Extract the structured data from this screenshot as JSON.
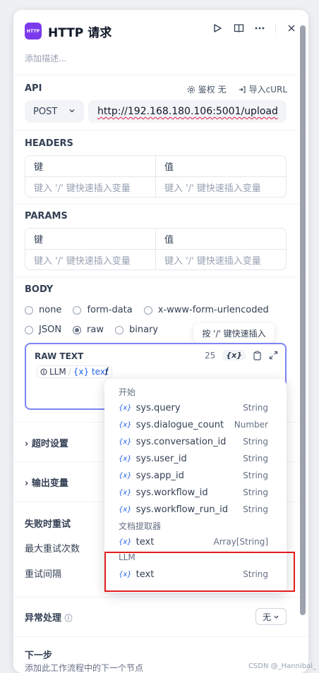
{
  "panel": {
    "app_icon_text": "HTTP",
    "title": "HTTP 请求",
    "description_placeholder": "添加描述..."
  },
  "api": {
    "label": "API",
    "auth_label": "鉴权 无",
    "import_label": "导入cURL",
    "method": "POST",
    "url": "http://192.168.180.106:5001/upload"
  },
  "headers": {
    "label": "HEADERS",
    "key_header": "键",
    "value_header": "值",
    "key_placeholder": "键入 '/' 键快速插入变量",
    "value_placeholder": "键入 '/' 键快速插入变量"
  },
  "params": {
    "label": "PARAMS",
    "key_header": "键",
    "value_header": "值",
    "key_placeholder": "键入 '/' 键快速插入变量",
    "value_placeholder": "键入 '/' 键快速插入变量"
  },
  "body": {
    "label": "BODY",
    "options": [
      "none",
      "form-data",
      "x-www-form-urlencoded",
      "JSON",
      "raw",
      "binary"
    ],
    "selected": "raw",
    "tooltip": "按 '/' 键快速插入",
    "raw_title": "RAW TEXT",
    "char_count": "25",
    "var_btn": "{x}",
    "chip_node": "LLM",
    "chip_sep": "/",
    "chip_var": "{x} text",
    "typed": "/"
  },
  "sections": {
    "timeout": "超时设置",
    "output_vars": "输出变量",
    "retry_on_fail": "失败时重试",
    "max_retries": "最大重试次数",
    "retry_interval": "重试间隔",
    "error_handling": "异常处理",
    "error_handling_value": "无",
    "next_step": "下一步",
    "next_step_desc": "添加此工作流程中的下一个节点"
  },
  "var_popup": {
    "groups": [
      {
        "title": "开始",
        "items": [
          {
            "name": "sys.query",
            "type": "String"
          },
          {
            "name": "sys.dialogue_count",
            "type": "Number"
          },
          {
            "name": "sys.conversation_id",
            "type": "String"
          },
          {
            "name": "sys.user_id",
            "type": "String"
          },
          {
            "name": "sys.app_id",
            "type": "String"
          },
          {
            "name": "sys.workflow_id",
            "type": "String"
          },
          {
            "name": "sys.workflow_run_id",
            "type": "String"
          }
        ]
      },
      {
        "title": "文档提取器",
        "items": [
          {
            "name": "text",
            "type": "Array[String]"
          }
        ]
      },
      {
        "title": "LLM",
        "items": [
          {
            "name": "text",
            "type": "String"
          }
        ]
      }
    ],
    "var_prefix": "{x}"
  },
  "watermark": "CSDN @_Hannibal_"
}
